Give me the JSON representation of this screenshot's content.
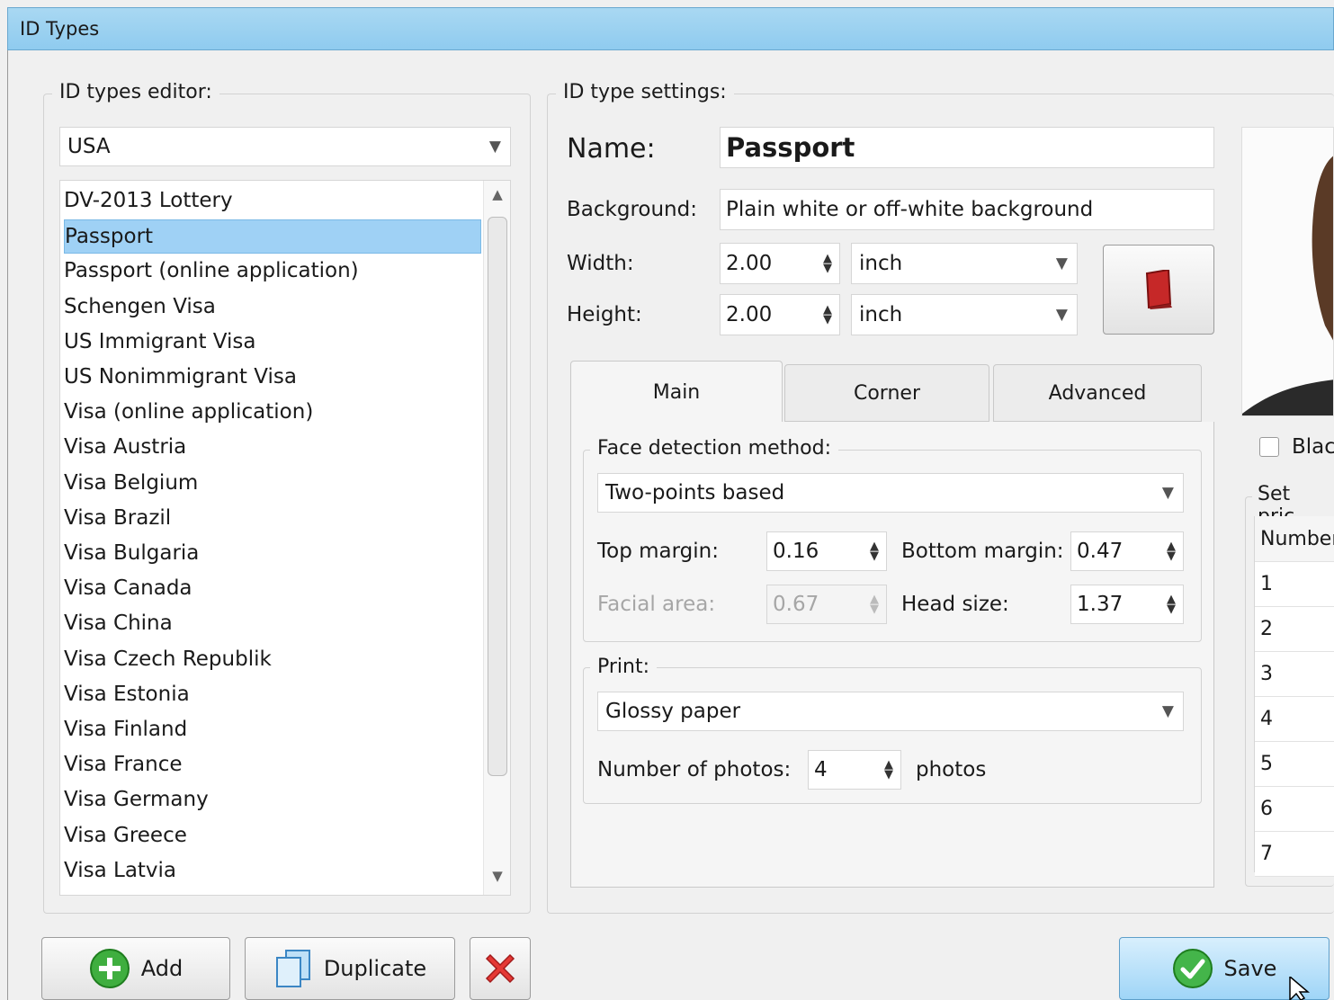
{
  "window": {
    "title": "ID Types"
  },
  "editor": {
    "group_label": "ID types editor:",
    "country": "USA",
    "items": [
      {
        "label": "DV-2013 Lottery"
      },
      {
        "label": "Passport",
        "selected": true
      },
      {
        "label": "Passport (online application)"
      },
      {
        "label": "Schengen Visa"
      },
      {
        "label": "US Immigrant Visa"
      },
      {
        "label": "US Nonimmigrant Visa"
      },
      {
        "label": "Visa (online application)"
      },
      {
        "label": "Visa Austria"
      },
      {
        "label": "Visa Belgium"
      },
      {
        "label": "Visa Brazil"
      },
      {
        "label": "Visa Bulgaria"
      },
      {
        "label": "Visa Canada"
      },
      {
        "label": "Visa China"
      },
      {
        "label": "Visa Czech Republik"
      },
      {
        "label": "Visa Estonia"
      },
      {
        "label": "Visa Finland"
      },
      {
        "label": "Visa France"
      },
      {
        "label": "Visa Germany"
      },
      {
        "label": "Visa Greece"
      },
      {
        "label": "Visa Latvia"
      }
    ]
  },
  "settings": {
    "group_label": "ID type settings:",
    "name_label": "Name:",
    "name_value": "Passport",
    "background_label": "Background:",
    "background_value": "Plain white or off-white background",
    "width_label": "Width:",
    "width_value": "2.00",
    "width_unit": "inch",
    "height_label": "Height:",
    "height_value": "2.00",
    "height_unit": "inch",
    "tabs": [
      "Main",
      "Corner",
      "Advanced"
    ],
    "face": {
      "group_label": "Face detection method:",
      "method": "Two-points based",
      "top_margin_label": "Top margin:",
      "top_margin": "0.16",
      "bottom_margin_label": "Bottom margin:",
      "bottom_margin": "0.47",
      "facial_area_label": "Facial area:",
      "facial_area": "0.67",
      "head_size_label": "Head size:",
      "head_size": "1.37"
    },
    "print": {
      "group_label": "Print:",
      "paper": "Glossy paper",
      "photos_label": "Number of photos:",
      "photos_value": "4",
      "photos_unit": "photos"
    }
  },
  "right": {
    "checkbox_label": "Blac",
    "price_group_label": "Set pric",
    "price_header": "Number",
    "rows": [
      "1",
      "2",
      "3",
      "4",
      "5",
      "6",
      "7"
    ]
  },
  "buttons": {
    "add": "Add",
    "duplicate": "Duplicate",
    "save": "Save"
  },
  "colors": {
    "selection": "#9fd1f5",
    "titlebar": "#8fcbef",
    "save_button": "#9fd5f7"
  }
}
